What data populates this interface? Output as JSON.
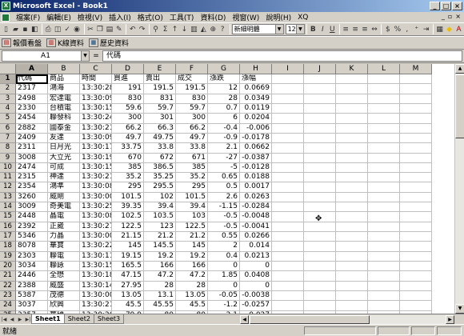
{
  "window": {
    "title": "Microsoft Excel - Book1",
    "app_icon": "X"
  },
  "menu": {
    "items": [
      "檔案(F)",
      "編輯(E)",
      "檢視(V)",
      "插入(I)",
      "格式(O)",
      "工具(T)",
      "資料(D)",
      "視窗(W)",
      "說明(H)",
      "XQ"
    ]
  },
  "toolbar": {
    "font_name": "新細明體",
    "font_size": "12",
    "bold": "B",
    "italic": "I",
    "underline": "U"
  },
  "toolbar2": {
    "plugins": [
      {
        "icon": "quote-icon",
        "label": "報價看盤"
      },
      {
        "icon": "kline-icon",
        "label": "K線資料"
      },
      {
        "icon": "history-icon",
        "label": "歷史資料"
      }
    ]
  },
  "formula_bar": {
    "cell_ref": "A1",
    "eq": "=",
    "content": "代碼"
  },
  "columns": [
    "A",
    "B",
    "C",
    "D",
    "E",
    "F",
    "G",
    "H",
    "I",
    "J",
    "K",
    "L",
    "M"
  ],
  "header_row": [
    "代碼",
    "商品",
    "時間",
    "買進",
    "賣出",
    "成交",
    "漲跌",
    "漲幅"
  ],
  "rows": [
    [
      "2317",
      "鴻海",
      "13:30:28",
      "191",
      "191.5",
      "191.5",
      "12",
      "0.0669"
    ],
    [
      "2498",
      "宏達電",
      "13:30:09",
      "830",
      "831",
      "830",
      "28",
      "0.0349"
    ],
    [
      "2330",
      "台積電",
      "13:30:15",
      "59.6",
      "59.7",
      "59.7",
      "0.7",
      "0.0119"
    ],
    [
      "2454",
      "聯發科",
      "13:30:24",
      "300",
      "301",
      "300",
      "6",
      "0.0204"
    ],
    [
      "2882",
      "國泰金",
      "13:30:21",
      "66.2",
      "66.3",
      "66.2",
      "-0.4",
      "-0.006"
    ],
    [
      "2409",
      "友達",
      "13:30:09",
      "49.7",
      "49.75",
      "49.7",
      "-0.9",
      "-0.0178"
    ],
    [
      "2311",
      "日月光",
      "13:30:17",
      "33.75",
      "33.8",
      "33.8",
      "2.1",
      "0.0662"
    ],
    [
      "3008",
      "大立光",
      "13:30:19",
      "670",
      "672",
      "671",
      "-27",
      "-0.0387"
    ],
    [
      "2474",
      "可成",
      "13:30:15",
      "385",
      "386.5",
      "385",
      "-5",
      "-0.0128"
    ],
    [
      "2315",
      "神達",
      "13:30:21",
      "35.2",
      "35.25",
      "35.2",
      "0.65",
      "0.0188"
    ],
    [
      "2354",
      "鴻準",
      "13:30:08",
      "295",
      "295.5",
      "295",
      "0.5",
      "0.0017"
    ],
    [
      "3260",
      "威剛",
      "13:30:00",
      "101.5",
      "102",
      "101.5",
      "2.6",
      "0.0263"
    ],
    [
      "3009",
      "奇美電",
      "13:30:25",
      "39.35",
      "39.4",
      "39.4",
      "-1.15",
      "-0.0284"
    ],
    [
      "2448",
      "晶電",
      "13:30:08",
      "102.5",
      "103.5",
      "103",
      "-0.5",
      "-0.0048"
    ],
    [
      "2392",
      "正崴",
      "13:30:27",
      "122.5",
      "123",
      "122.5",
      "-0.5",
      "-0.0041"
    ],
    [
      "5346",
      "力晶",
      "13:30:00",
      "21.15",
      "21.2",
      "21.2",
      "0.55",
      "0.0266"
    ],
    [
      "8078",
      "華寶",
      "13:30:22",
      "145",
      "145.5",
      "145",
      "2",
      "0.014"
    ],
    [
      "2303",
      "聯電",
      "13:30:11",
      "19.15",
      "19.2",
      "19.2",
      "0.4",
      "0.0213"
    ],
    [
      "3034",
      "聯詠",
      "13:30:15",
      "165.5",
      "166",
      "166",
      "0",
      "0"
    ],
    [
      "2446",
      "全懋",
      "13:30:18",
      "47.15",
      "47.2",
      "47.2",
      "1.85",
      "0.0408"
    ],
    [
      "2388",
      "威盛",
      "13:30:14",
      "27.95",
      "28",
      "28",
      "0",
      "0"
    ],
    [
      "5387",
      "茂德",
      "13:30:00",
      "13.05",
      "13.1",
      "13.05",
      "-0.05",
      "-0.0038"
    ],
    [
      "3037",
      "欣興",
      "13:30:21",
      "45.5",
      "45.55",
      "45.5",
      "-1.2",
      "-0.0257"
    ],
    [
      "2357",
      "華碩",
      "13:30:20",
      "79.9",
      "80",
      "80",
      "2.1",
      "0.027"
    ]
  ],
  "sheets": [
    "Sheet1",
    "Sheet2",
    "Sheet3"
  ],
  "active_sheet": "Sheet1",
  "status": {
    "text": "就緒"
  }
}
